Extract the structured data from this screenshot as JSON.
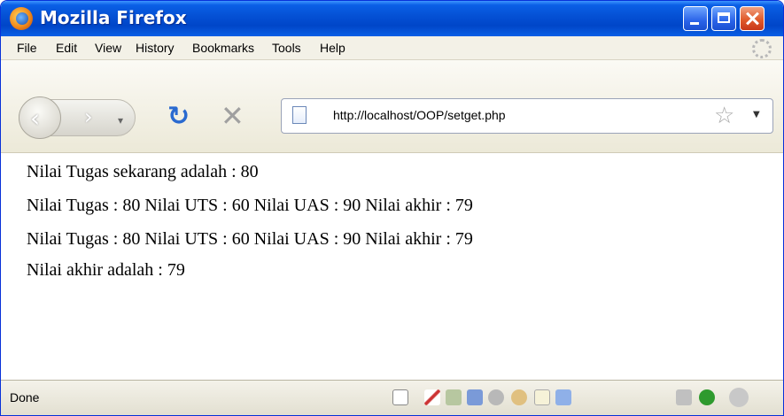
{
  "window": {
    "title": "Mozilla Firefox"
  },
  "menu": {
    "items": [
      "File",
      "Edit",
      "View",
      "History",
      "Bookmarks",
      "Tools",
      "Help"
    ]
  },
  "toolbar": {
    "url": "http://localhost/OOP/setget.php"
  },
  "content": {
    "lines": [
      "Nilai Tugas sekarang adalah : 80",
      "Nilai Tugas : 80 Nilai UTS : 60 Nilai UAS : 90 Nilai akhir : 79",
      "Nilai Tugas : 80 Nilai UTS : 60 Nilai UAS : 90 Nilai akhir : 79",
      "Nilai akhir adalah : 79"
    ]
  },
  "status": {
    "text": "Done"
  },
  "colors": {
    "titlebar": "#0552d6",
    "close_button": "#e05a2a",
    "reload": "#2a6ad0"
  },
  "icons": {
    "app": "firefox-logo-icon",
    "back": "back-arrow-icon",
    "forward": "forward-arrow-icon",
    "reload": "reload-icon",
    "stop": "stop-icon",
    "page": "page-icon",
    "bookmark": "star-icon",
    "throbber": "throbber-icon"
  }
}
